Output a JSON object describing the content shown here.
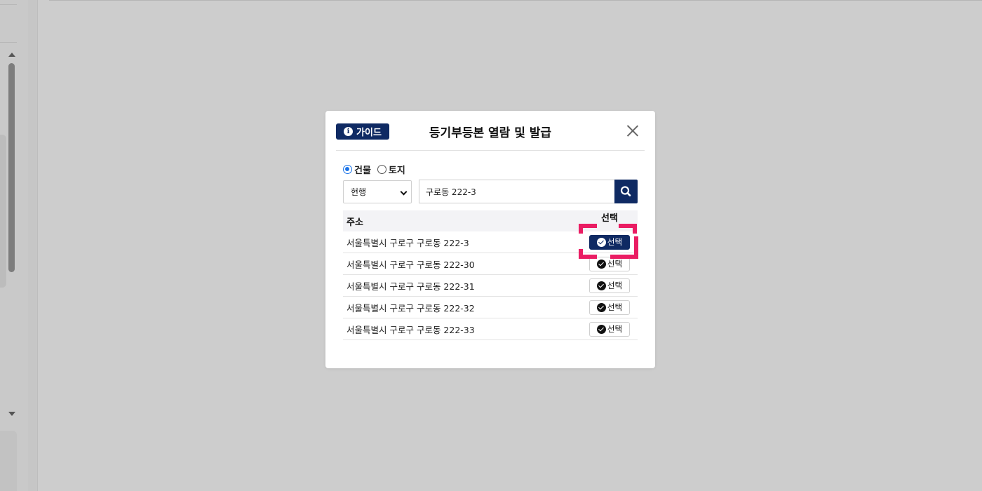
{
  "modal": {
    "guide_label": "가이드",
    "title": "등기부등본 열람 및 발급",
    "radio": [
      {
        "label": "건물",
        "checked": true
      },
      {
        "label": "토지",
        "checked": false
      }
    ],
    "select_value": "현행",
    "search_value": "구로동 222-3",
    "table": {
      "headers": [
        "주소",
        "선택"
      ],
      "rows": [
        {
          "address": "서울특별시 구로구 구로동 222-3",
          "button": "선택"
        },
        {
          "address": "서울특별시 구로구 구로동 222-30",
          "button": "선택"
        },
        {
          "address": "서울특별시 구로구 구로동 222-31",
          "button": "선택"
        },
        {
          "address": "서울특별시 구로구 구로동 222-32",
          "button": "선택"
        },
        {
          "address": "서울특별시 구로구 구로동 222-33",
          "button": "선택"
        }
      ]
    }
  },
  "colors": {
    "navy": "#0f2a63",
    "highlight": "#ea1c63",
    "radio_checked": "#1a73e8"
  }
}
